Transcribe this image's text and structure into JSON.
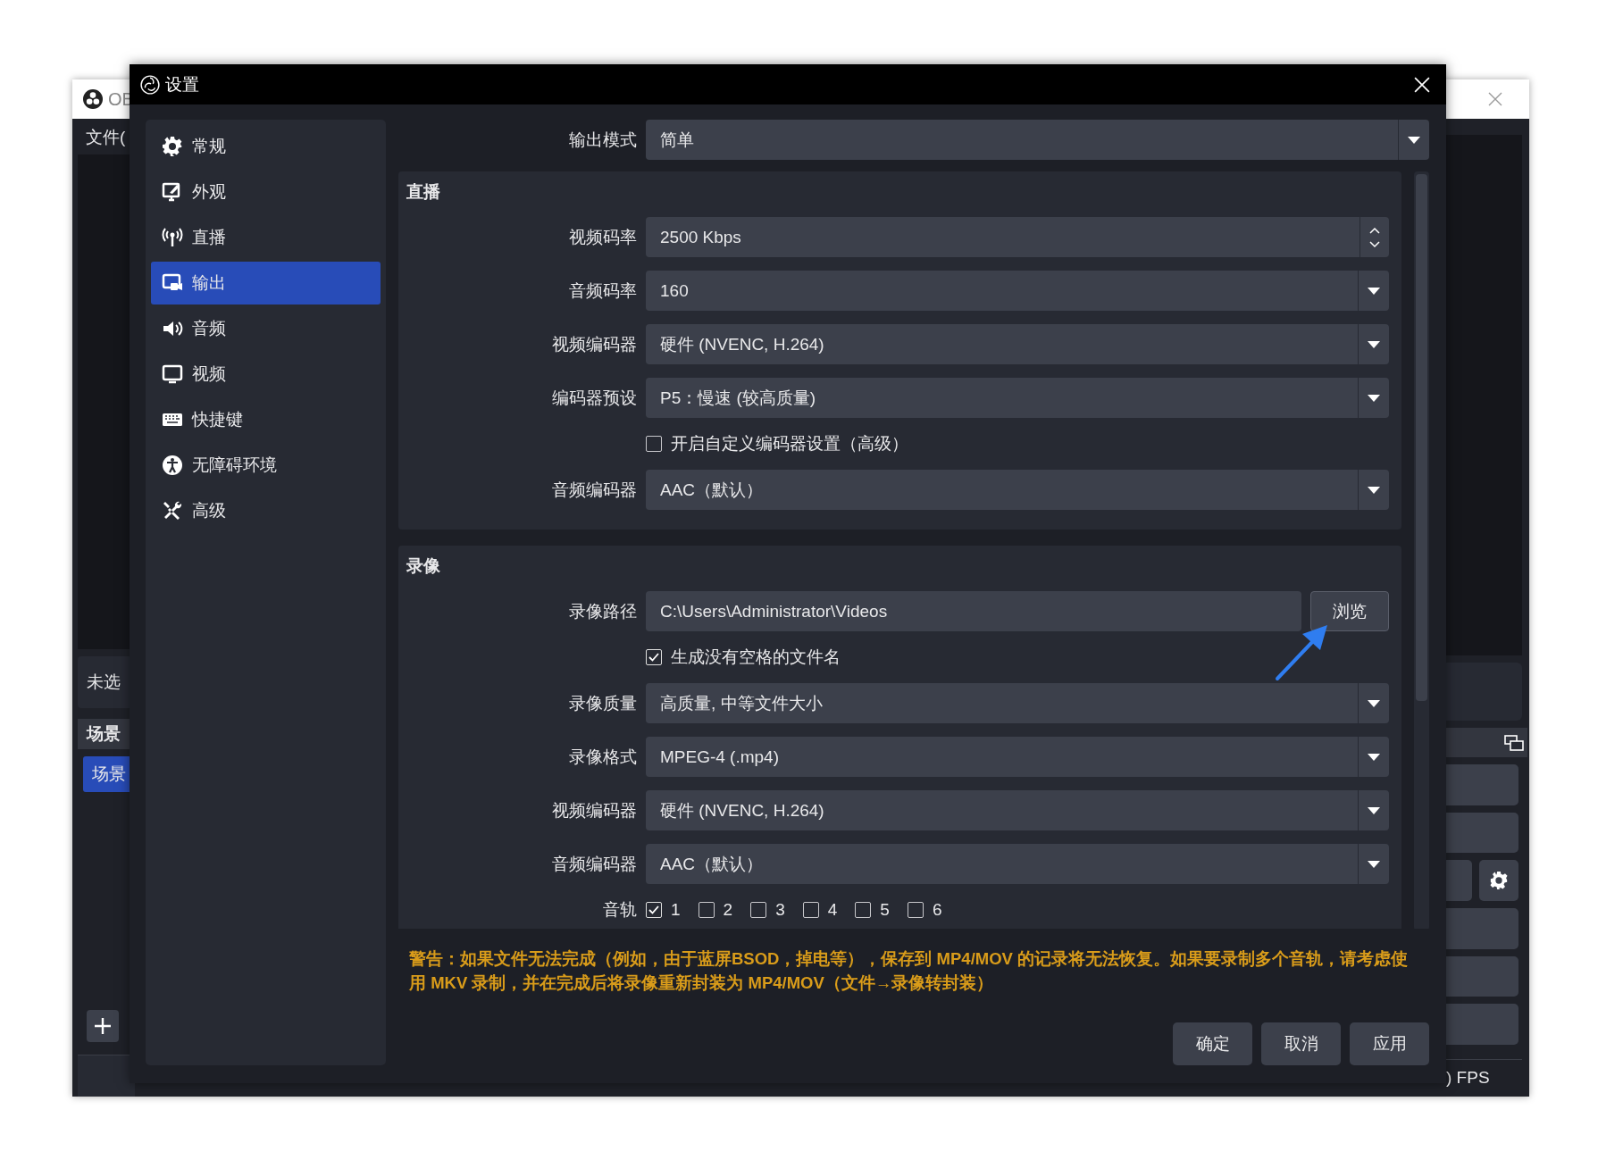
{
  "background_window": {
    "title": "OB",
    "menu": "文件(",
    "status": "未选",
    "scenes_header": "场景",
    "scene_item": {
      "label": "场景",
      "selected": true
    },
    "fps": ") FPS"
  },
  "dialog": {
    "title": "设置"
  },
  "sidebar": [
    {
      "label": "常规",
      "selected": false
    },
    {
      "label": "外观",
      "selected": false
    },
    {
      "label": "直播",
      "selected": false
    },
    {
      "label": "输出",
      "selected": true
    },
    {
      "label": "音频",
      "selected": false
    },
    {
      "label": "视频",
      "selected": false
    },
    {
      "label": "快捷键",
      "selected": false
    },
    {
      "label": "无障碍环境",
      "selected": false
    },
    {
      "label": "高级",
      "selected": false
    }
  ],
  "output_mode": {
    "label": "输出模式",
    "value": "简单"
  },
  "streaming": {
    "title": "直播",
    "rows": [
      {
        "kind": "spin",
        "label": "视频码率",
        "value": "2500 Kbps"
      },
      {
        "kind": "select",
        "label": "音频码率",
        "value": "160"
      },
      {
        "kind": "select",
        "label": "视频编码器",
        "value": "硬件 (NVENC, H.264)"
      },
      {
        "kind": "select",
        "label": "编码器预设",
        "value": "P5：慢速 (较高质量)"
      },
      {
        "kind": "checkbox",
        "label": "开启自定义编码器设置（高级）",
        "checked": false
      },
      {
        "kind": "select",
        "label": "音频编码器",
        "value": "AAC（默认）"
      }
    ]
  },
  "recording": {
    "title": "录像",
    "rows": [
      {
        "kind": "path",
        "label": "录像路径",
        "value": "C:\\Users\\Administrator\\Videos",
        "button": "浏览"
      },
      {
        "kind": "checkbox",
        "label": "生成没有空格的文件名",
        "checked": true
      },
      {
        "kind": "select",
        "label": "录像质量",
        "value": "高质量, 中等文件大小"
      },
      {
        "kind": "select",
        "label": "录像格式",
        "value": "MPEG-4 (.mp4)"
      },
      {
        "kind": "select",
        "label": "视频编码器",
        "value": "硬件 (NVENC, H.264)"
      },
      {
        "kind": "select",
        "label": "音频编码器",
        "value": "AAC（默认）"
      },
      {
        "kind": "tracks",
        "label": "音轨",
        "tracks": [
          {
            "label": "1",
            "checked": true
          },
          {
            "label": "2",
            "checked": false
          },
          {
            "label": "3",
            "checked": false
          },
          {
            "label": "4",
            "checked": false
          },
          {
            "label": "5",
            "checked": false
          },
          {
            "label": "6",
            "checked": false
          }
        ]
      }
    ]
  },
  "warning": "警告：如果文件无法完成（例如，由于蓝屏BSOD，掉电等），保存到 MP4/MOV 的记录将无法恢复。如果要录制多个音轨，请考虑使用 MKV 录制，并在完成后将录像重新封装为 MP4/MOV（文件→录像转封装）",
  "buttons": [
    "确定",
    "取消",
    "应用"
  ]
}
